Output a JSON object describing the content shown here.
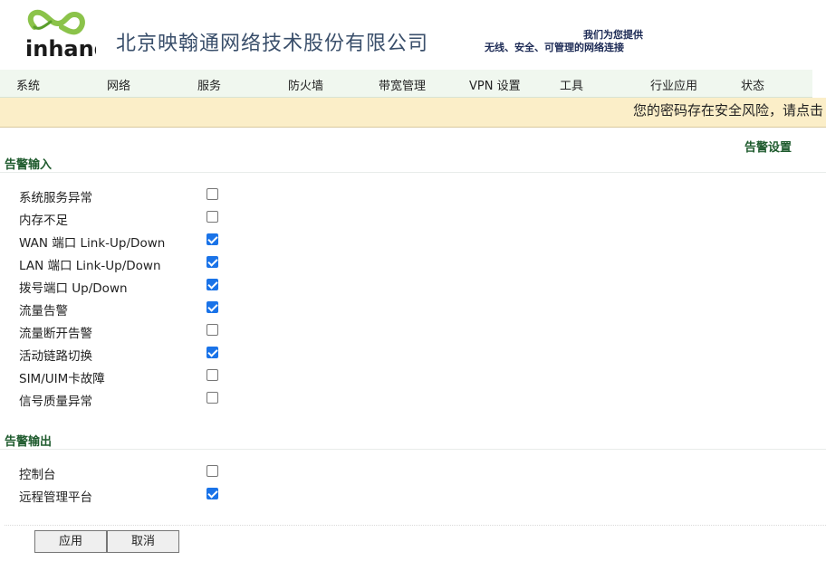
{
  "header": {
    "logo_text": "inhand",
    "company_name": "北京映翰通网络技术股份有限公司",
    "slogan_line1": "我们为您提供",
    "slogan_line2": "无线、安全、可管理的网络连接"
  },
  "nav": {
    "items": [
      "系统",
      "网络",
      "服务",
      "防火墙",
      "带宽管理",
      "VPN 设置",
      "工具",
      "行业应用",
      "状态"
    ]
  },
  "warning": {
    "text": "您的密码存在安全风险，请点击"
  },
  "page_title": "告警设置",
  "alarm_input": {
    "title": "告警输入",
    "items": [
      {
        "label": "系统服务异常",
        "checked": false
      },
      {
        "label": "内存不足",
        "checked": false
      },
      {
        "label": "WAN 端口 Link-Up/Down",
        "checked": true
      },
      {
        "label": "LAN 端口 Link-Up/Down",
        "checked": true
      },
      {
        "label": "拨号端口 Up/Down",
        "checked": true
      },
      {
        "label": "流量告警",
        "checked": true
      },
      {
        "label": "流量断开告警",
        "checked": false
      },
      {
        "label": "活动链路切换",
        "checked": true
      },
      {
        "label": "SIM/UIM卡故障",
        "checked": false
      },
      {
        "label": "信号质量异常",
        "checked": false
      }
    ]
  },
  "alarm_output": {
    "title": "告警输出",
    "items": [
      {
        "label": "控制台",
        "checked": false
      },
      {
        "label": "远程管理平台",
        "checked": true
      }
    ]
  },
  "buttons": {
    "apply": "应用",
    "cancel": "取消"
  },
  "colors": {
    "checkbox_checked": "#1a73e8",
    "section_title": "#1f5b2e",
    "warning_bg": "#fbeec8",
    "nav_bg": "#f0f7ef"
  }
}
